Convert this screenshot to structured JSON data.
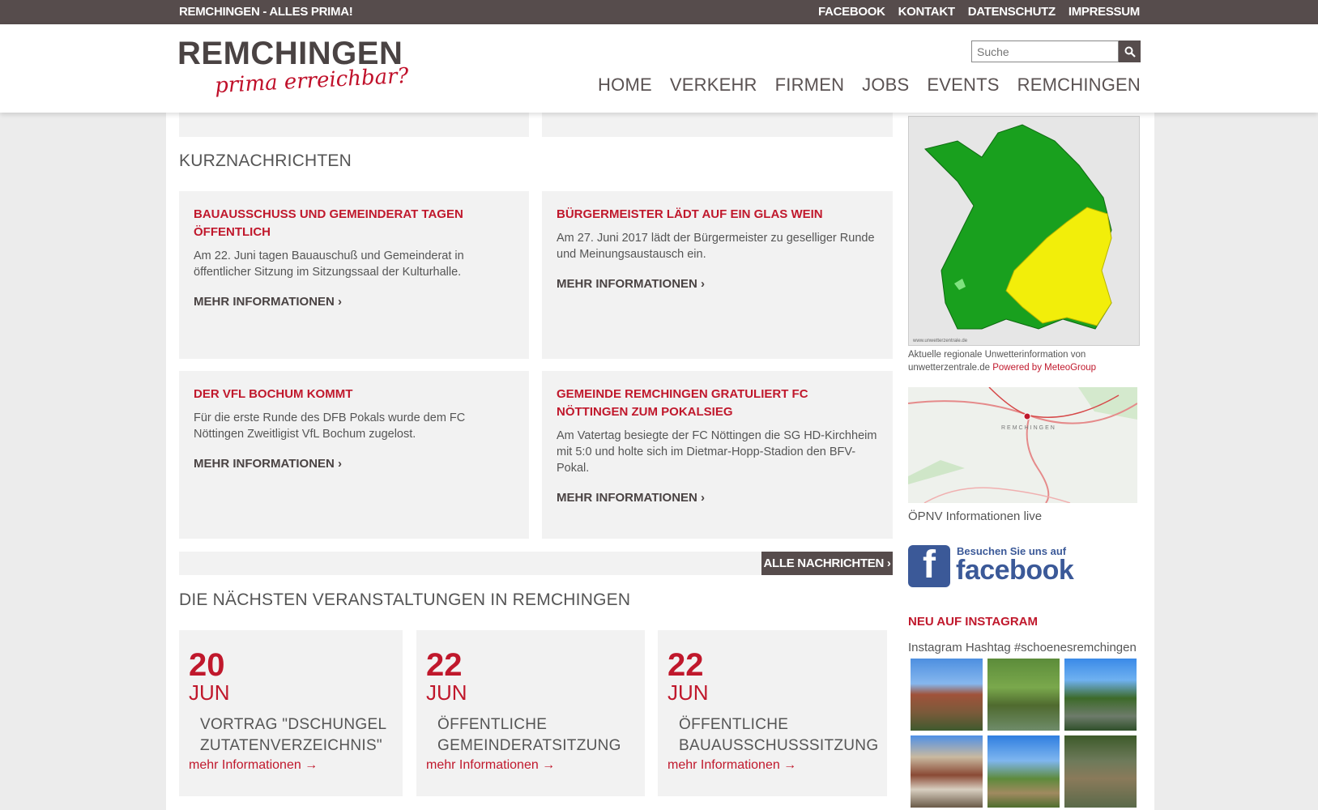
{
  "topbar": {
    "slogan": "REMCHINGEN - ALLES PRIMA!",
    "links": [
      "FACEBOOK",
      "KONTAKT",
      "DATENSCHUTZ",
      "IMPRESSUM"
    ]
  },
  "header": {
    "logo_main": "REMCHINGEN",
    "logo_sub": "prima erreichbar?",
    "search_placeholder": "Suche",
    "nav": [
      "HOME",
      "VERKEHR",
      "FIRMEN",
      "JOBS",
      "EVENTS",
      "REMCHINGEN"
    ]
  },
  "news_section": {
    "title": "KURZNACHRICHTEN",
    "items": [
      {
        "title": "BAUAUSSCHUSS UND GEMEINDERAT TAGEN ÖFFENTLICH",
        "text": "Am 22. Juni tagen Bauauschuß und Gemeinderat in öffentlicher Sitzung im Sitzungssaal der Kulturhalle.",
        "more": "MEHR INFORMATIONEN ›"
      },
      {
        "title": "BÜRGERMEISTER LÄDT AUF EIN GLAS WEIN",
        "text": "Am 27. Juni 2017 lädt der Bürgermeister zu geselliger Runde und Meinungsaustausch ein.",
        "more": "MEHR INFORMATIONEN ›"
      },
      {
        "title": "DER VFL BOCHUM KOMMT",
        "text": "Für die erste Runde des DFB Pokals wurde dem FC Nöttingen Zweitligist VfL Bochum zugelost.",
        "more": "MEHR INFORMATIONEN ›"
      },
      {
        "title": "GEMEINDE REMCHINGEN GRATULIERT FC NÖTTINGEN ZUM POKALSIEG",
        "text": "Am Vatertag besiegte der FC Nöttingen die SG HD-Kirchheim mit 5:0 und holte sich im Dietmar-Hopp-Stadion den BFV-Pokal.",
        "more": "MEHR INFORMATIONEN ›"
      }
    ],
    "all_news": "ALLE NACHRICHTEN ›"
  },
  "events_section": {
    "title": "DIE NÄCHSTEN VERANSTALTUNGEN IN REMCHINGEN",
    "items": [
      {
        "day": "20",
        "month": "JUN",
        "title": "VORTRAG \"DSCHUNGEL ZUTATENVERZEICHNIS\"",
        "more": "mehr Informationen →"
      },
      {
        "day": "22",
        "month": "JUN",
        "title": "ÖFFENTLICHE GEMEINDERATSITZUNG",
        "more": "mehr Informationen →"
      },
      {
        "day": "22",
        "month": "JUN",
        "title": "ÖFFENTLICHE BAUAUSSCHUSSSITZUNG",
        "more": "mehr Informationen →"
      }
    ]
  },
  "sidebar": {
    "weather_caption": "Aktuelle regionale Unwetterinformation von unwetterzentrale.de",
    "weather_powered": "Powered by MeteoGroup",
    "opnv_label": "ÖPNV Informationen live",
    "map_town": "REMCHINGEN",
    "facebook_small": "Besuchen Sie uns auf",
    "facebook_big": "facebook",
    "instagram_title": "NEU AUF INSTAGRAM",
    "instagram_sub": "Instagram Hashtag #schoenesremchingen"
  },
  "colors": {
    "accent": "#c0182c",
    "bar": "#564c4c",
    "facebook": "#3b5998"
  }
}
